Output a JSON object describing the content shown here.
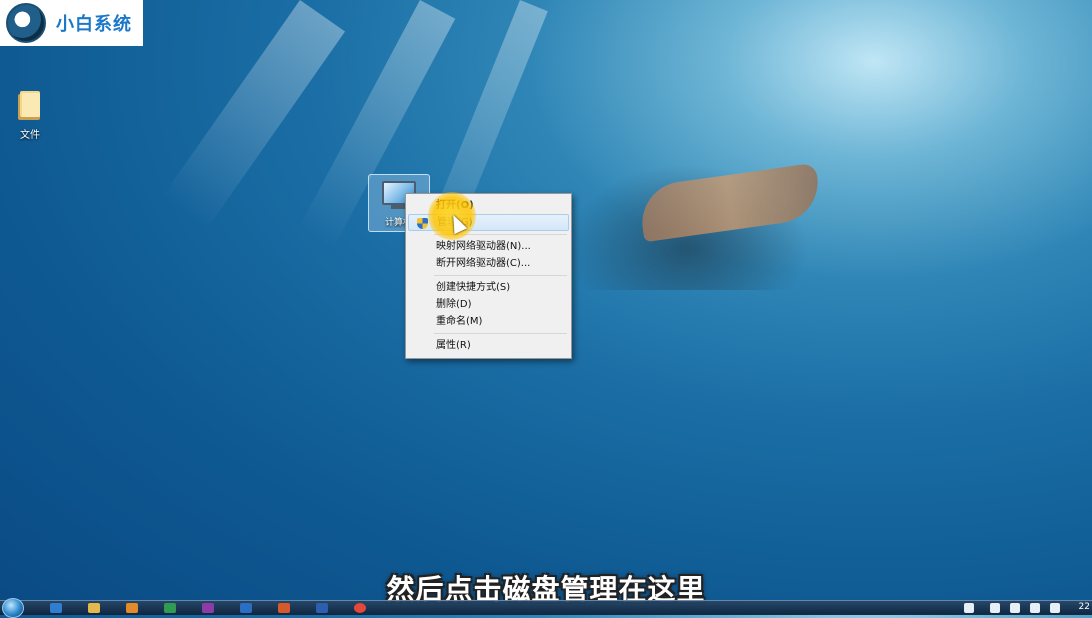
{
  "logo": {
    "text": "小白系统"
  },
  "desktop": {
    "icons": [
      {
        "label": "文件"
      },
      {
        "label": "计算机"
      }
    ]
  },
  "context_menu": {
    "items": [
      {
        "label": "打开(O)"
      },
      {
        "label": "管理(G)"
      },
      {
        "label": "映射网络驱动器(N)..."
      },
      {
        "label": "断开网络驱动器(C)..."
      },
      {
        "label": "创建快捷方式(S)"
      },
      {
        "label": "删除(D)"
      },
      {
        "label": "重命名(M)"
      },
      {
        "label": "属性(R)"
      }
    ]
  },
  "subtitle": "然后点击磁盘管理在这里",
  "taskbar": {
    "clock_text": "22"
  },
  "colors": {
    "subtitle_text": "#ffffff",
    "highlight": "#ffd628",
    "logo_text": "#1b78c9"
  }
}
